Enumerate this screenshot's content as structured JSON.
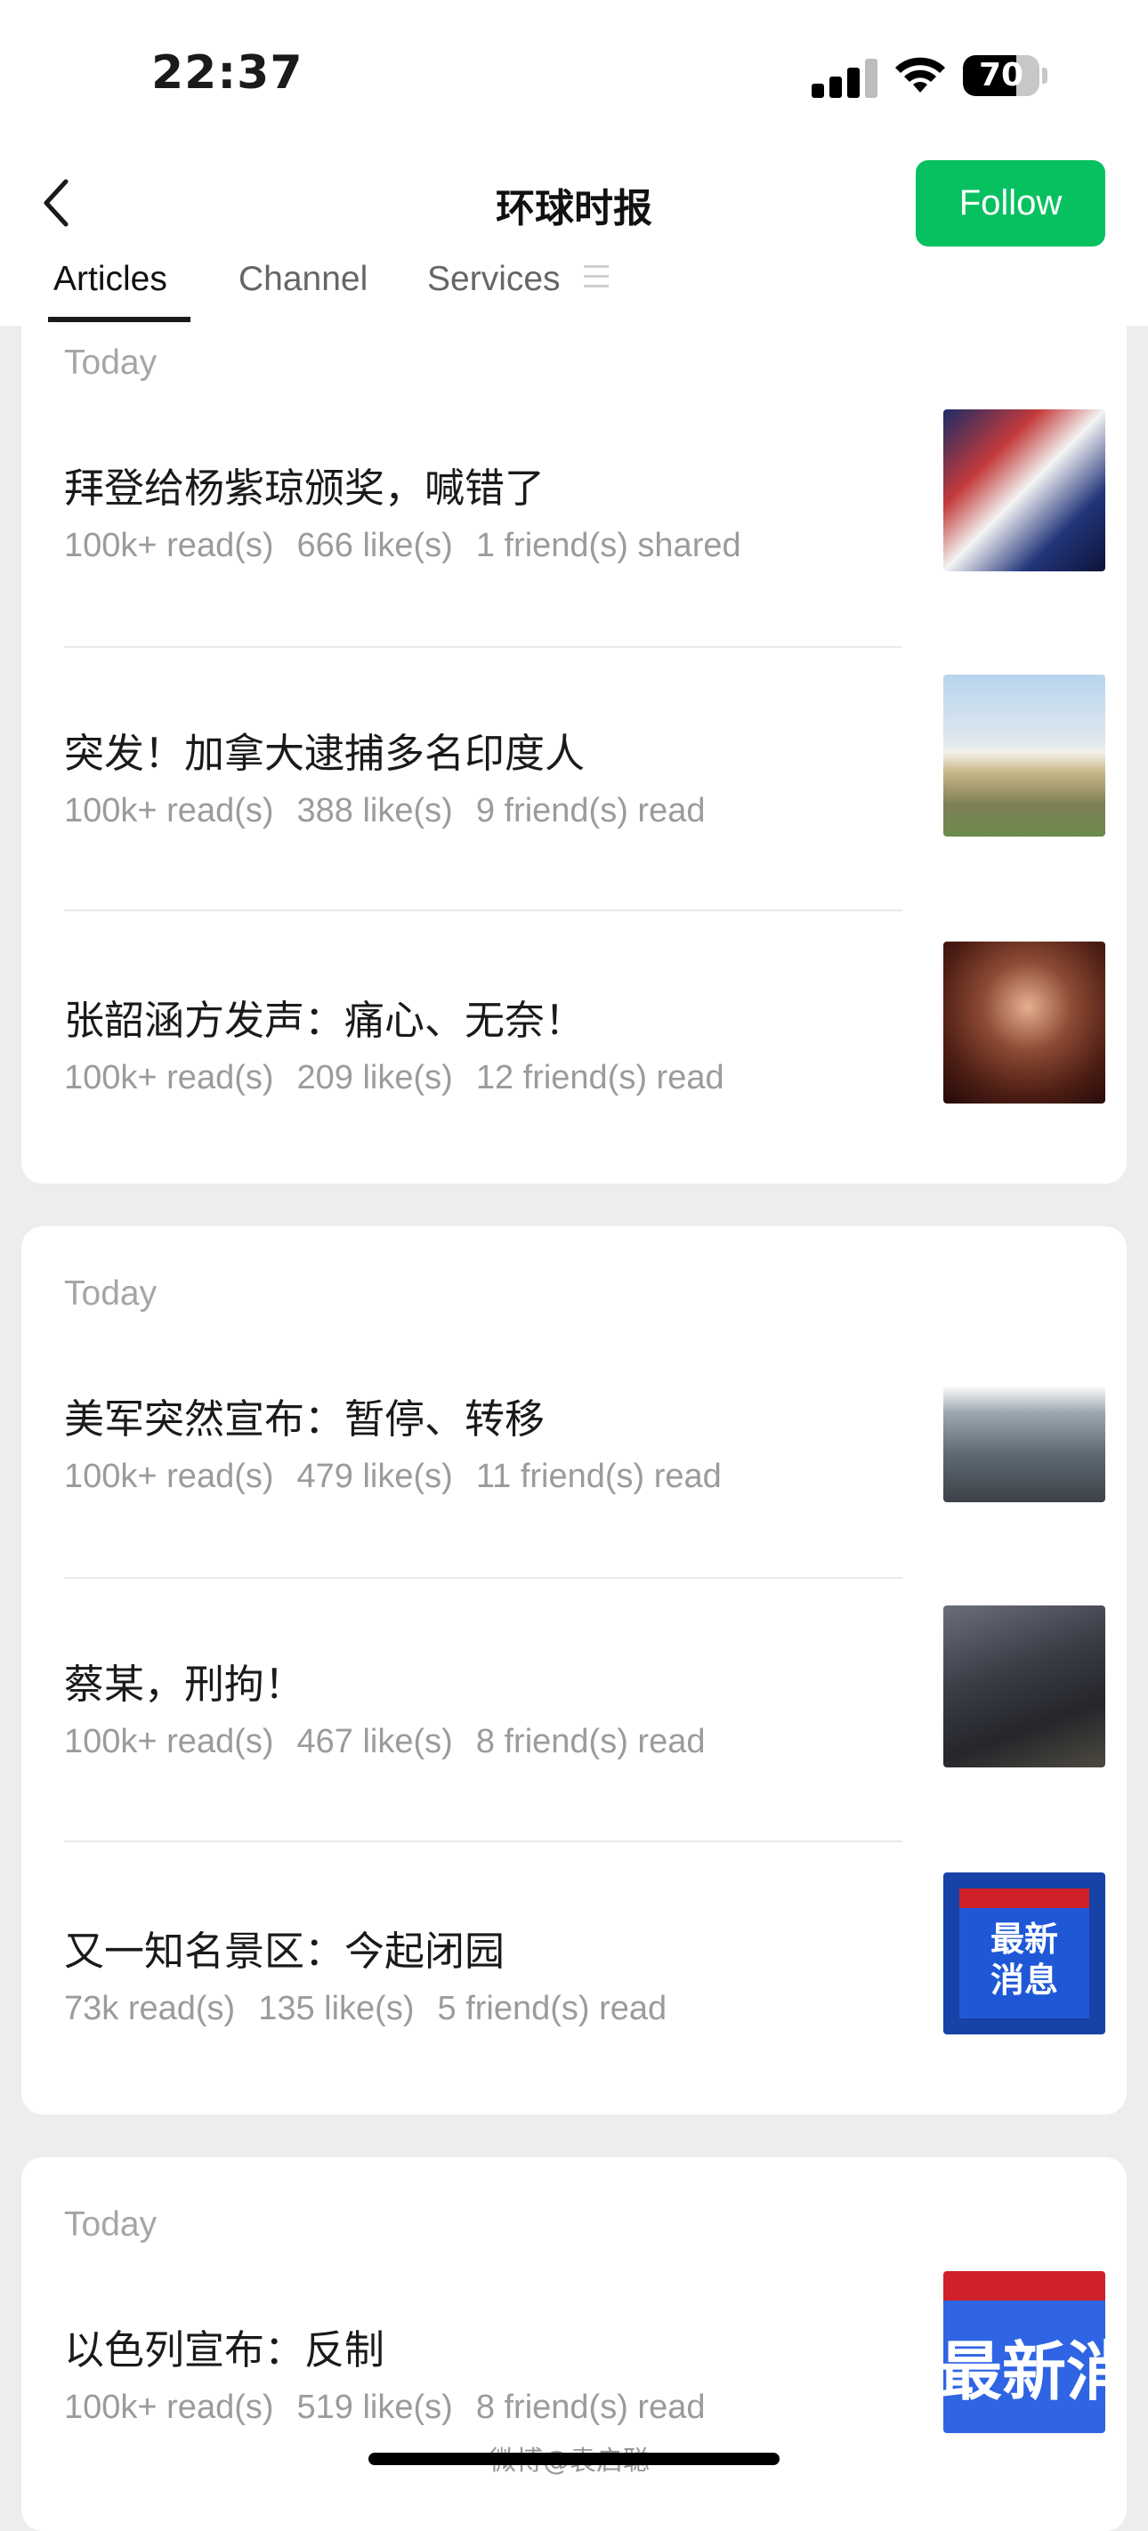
{
  "status_bar": {
    "time": "22:37",
    "battery_level": "70"
  },
  "nav": {
    "title": "环球时报",
    "follow_label": "Follow"
  },
  "tabs": [
    "Articles",
    "Channel",
    "Services"
  ],
  "cards": [
    {
      "date": "Today",
      "articles": [
        {
          "title": "拜登给杨紫琼颁奖，喊错了",
          "reads": "100k+ read(s)",
          "likes": "666 like(s)",
          "friends": "1 friend(s) shared"
        },
        {
          "title": "突发！加拿大逮捕多名印度人",
          "reads": "100k+ read(s)",
          "likes": "388 like(s)",
          "friends": "9 friend(s) read"
        },
        {
          "title": "张韶涵方发声：痛心、无奈！",
          "reads": "100k+ read(s)",
          "likes": "209 like(s)",
          "friends": "12 friend(s) read"
        }
      ]
    },
    {
      "date": "Today",
      "articles": [
        {
          "title": "美军突然宣布：暂停、转移",
          "reads": "100k+ read(s)",
          "likes": "479 like(s)",
          "friends": "11 friend(s) read"
        },
        {
          "title": "蔡某，刑拘！",
          "reads": "100k+ read(s)",
          "likes": "467 like(s)",
          "friends": "8 friend(s) read"
        },
        {
          "title": "又一知名景区：今起闭园",
          "reads": "73k read(s)",
          "likes": "135 like(s)",
          "friends": "5 friend(s) read",
          "thumb_text": "最新\n消息"
        }
      ]
    },
    {
      "date": "Today",
      "articles": [
        {
          "title": "以色列宣布：反制",
          "reads": "100k+ read(s)",
          "likes": "519 like(s)",
          "friends": "8 friend(s) read",
          "thumb_text": "最新消息"
        }
      ]
    }
  ],
  "watermark": "微博@袁启聪",
  "colors": {
    "accent": "#07c160",
    "page_bg": "#ededed"
  }
}
